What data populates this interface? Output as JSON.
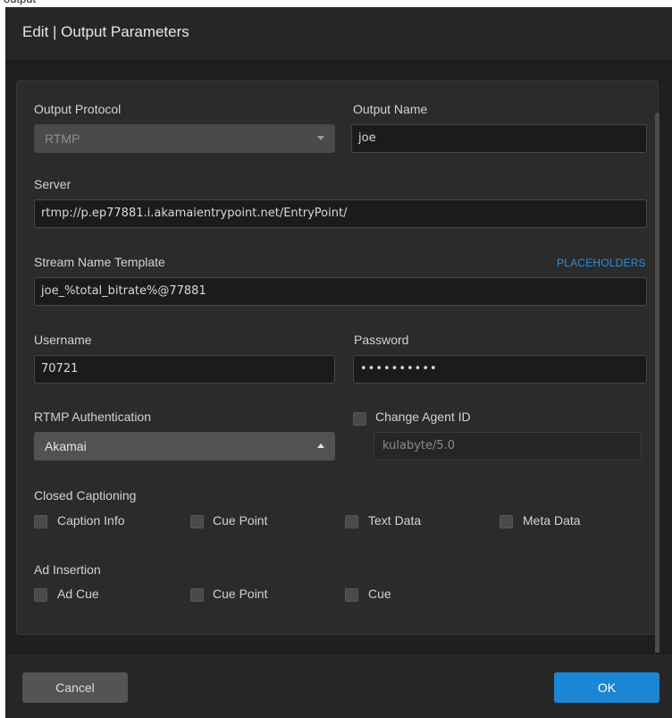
{
  "top_strip_text": "output",
  "dialog": {
    "title": "Edit | Output Parameters"
  },
  "fields": {
    "output_protocol": {
      "label": "Output Protocol",
      "value": "RTMP"
    },
    "output_name": {
      "label": "Output Name",
      "value": "joe"
    },
    "server": {
      "label": "Server",
      "value": "rtmp://p.ep77881.i.akamaientrypoint.net/EntryPoint/"
    },
    "stream_name_template": {
      "label": "Stream Name Template",
      "link": "PLACEHOLDERS",
      "value": "joe_%total_bitrate%@77881"
    },
    "username": {
      "label": "Username",
      "value": "70721"
    },
    "password": {
      "label": "Password",
      "value": "••••••••••"
    },
    "rtmp_authentication": {
      "label": "RTMP Authentication",
      "value": "Akamai"
    },
    "change_agent_id": {
      "label": "Change Agent ID",
      "checked": false,
      "placeholder": "kulabyte/5.0"
    }
  },
  "closed_captioning": {
    "label": "Closed Captioning",
    "options": [
      "Caption Info",
      "Cue Point",
      "Text Data",
      "Meta Data"
    ]
  },
  "ad_insertion": {
    "label": "Ad Insertion",
    "options": [
      "Ad Cue",
      "Cue Point",
      "Cue"
    ]
  },
  "footer": {
    "cancel_label": "Cancel",
    "ok_label": "OK"
  },
  "colors": {
    "accent": "#1a86d4",
    "link": "#2d8fdd",
    "background": "#1f1f1f",
    "panel": "#2b2b2b"
  }
}
